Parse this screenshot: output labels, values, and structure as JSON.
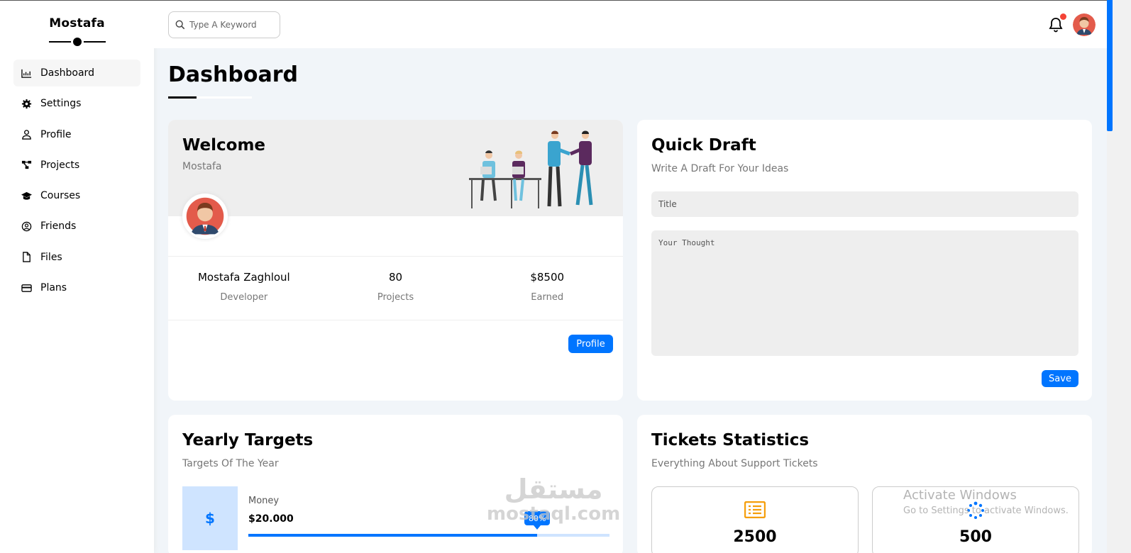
{
  "brand": {
    "name": "Mostafa"
  },
  "sidebar": {
    "items": [
      {
        "label": "Dashboard",
        "icon": "chart-area-icon",
        "active": true
      },
      {
        "label": "Settings",
        "icon": "gear-icon"
      },
      {
        "label": "Profile",
        "icon": "user-icon"
      },
      {
        "label": "Projects",
        "icon": "diagram-project-icon"
      },
      {
        "label": "Courses",
        "icon": "graduation-cap-icon"
      },
      {
        "label": "Friends",
        "icon": "user-circle-icon"
      },
      {
        "label": "Files",
        "icon": "file-icon"
      },
      {
        "label": "Plans",
        "icon": "credit-card-icon"
      }
    ]
  },
  "topbar": {
    "search_placeholder": "Type A Keyword",
    "notification_dot_color": "#f44336"
  },
  "page": {
    "title": "Dashboard"
  },
  "welcome": {
    "title": "Welcome",
    "subtitle": "Mostafa",
    "stats": [
      {
        "value": "Mostafa Zaghloul",
        "label": "Developer"
      },
      {
        "value": "80",
        "label": "Projects"
      },
      {
        "value": "$8500",
        "label": "Earned"
      }
    ],
    "profile_button": "Profile"
  },
  "draft": {
    "title": "Quick Draft",
    "subtitle": "Write A Draft For Your Ideas",
    "title_placeholder": "Title",
    "thought_placeholder": "Your Thought",
    "save_button": "Save"
  },
  "targets": {
    "title": "Yearly Targets",
    "subtitle": "Targets Of The Year",
    "items": [
      {
        "icon_symbol": "$",
        "label": "Money",
        "value": "$20.000",
        "progress_text": "80%",
        "progress_fraction": 0.8
      }
    ]
  },
  "tickets": {
    "title": "Tickets Statistics",
    "subtitle": "Everything About Support Tickets",
    "items": [
      {
        "icon": "list-icon",
        "value": "2500",
        "color": "#f59e0b"
      },
      {
        "icon": "spinner-icon",
        "value": "500",
        "color": "#0075ff"
      }
    ]
  },
  "overlays": {
    "watermark_line1": "مستقل",
    "watermark_line2": "mostaql.com",
    "activate_title": "Activate Windows",
    "activate_subtitle": "Go to Settings to activate Windows."
  },
  "colors": {
    "accent": "#0075ff",
    "page_bg": "#f1f5f9"
  }
}
